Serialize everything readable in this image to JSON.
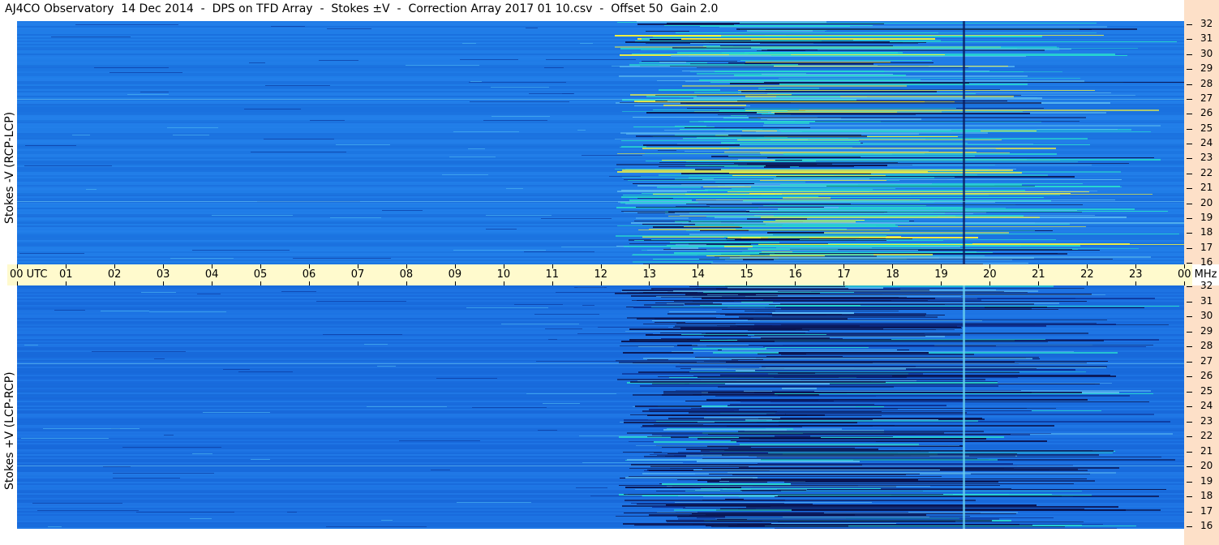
{
  "title": "AJ4CO Observatory  14 Dec 2014  -  DPS on TFD Array  -  Stokes ±V  -  Correction Array 2017 01 10.csv  -  Offset 50  Gain 2.0",
  "time_axis_labels": [
    "00",
    "01",
    "02",
    "03",
    "04",
    "05",
    "06",
    "07",
    "08",
    "09",
    "10",
    "11",
    "12",
    "13",
    "14",
    "15",
    "16",
    "17",
    "18",
    "19",
    "20",
    "21",
    "22",
    "23",
    "00"
  ],
  "time_axis_unit": "UTC",
  "freq_axis_unit": "MHz",
  "freq_labels": [
    "32",
    "31",
    "30",
    "29",
    "28",
    "27",
    "26",
    "25",
    "24",
    "23",
    "22",
    "21",
    "20",
    "19",
    "18",
    "17",
    "16"
  ],
  "colors": {
    "axis_bg": "#fffacd",
    "freq_bg": "#fde0c8",
    "base_blue": "#1a78e0",
    "deep_blue": "#1565c8",
    "cyan": "#28d8d0",
    "yellow": "#f0f040",
    "dark": "#0a1450"
  },
  "chart_data": [
    {
      "type": "heatmap",
      "title": "",
      "ylabel": "Stokes -V (RCP-LCP)",
      "xlabel": "UTC",
      "x_range": [
        "00",
        "00"
      ],
      "y_range_mhz": [
        16,
        32
      ],
      "y_unit": "MHz"
    },
    {
      "type": "heatmap",
      "title": "",
      "ylabel": "Stokes +V (LCP-RCP)",
      "xlabel": "UTC",
      "x_range": [
        "00",
        "00"
      ],
      "y_range_mhz": [
        16,
        32
      ],
      "y_unit": "MHz"
    }
  ]
}
